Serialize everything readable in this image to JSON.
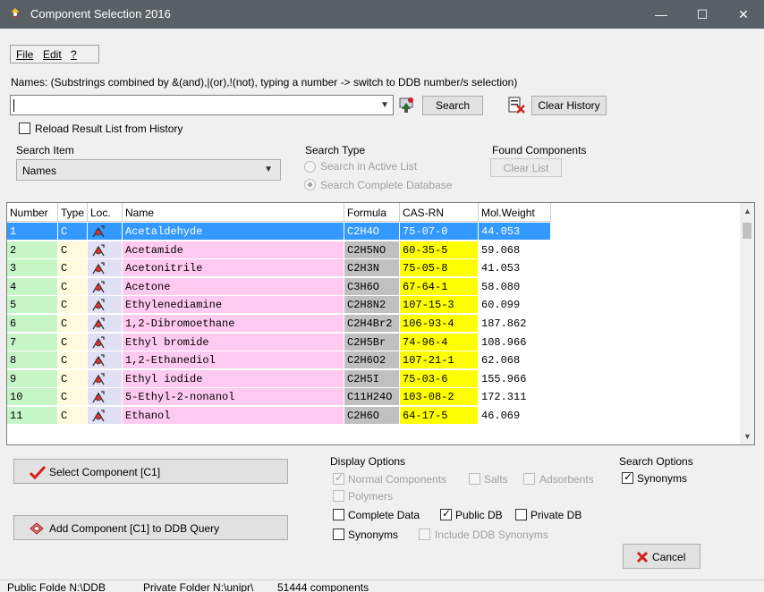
{
  "window": {
    "title": "Component Selection 2016",
    "minimize": "—",
    "maximize": "☐",
    "close": "✕"
  },
  "menu": {
    "file": "File",
    "edit": "Edit",
    "help": "?"
  },
  "names_label": "Names: (Substrings combined by &(and),|(or),!(not), typing a number -> switch to DDB number/s selection)",
  "search_input": {
    "value": ""
  },
  "buttons": {
    "search": "Search",
    "clear_history": "Clear History",
    "clear_list": "Clear List",
    "select_component": "Select Component [C1]",
    "add_component": "Add Component [C1] to DDB Query",
    "cancel": "Cancel"
  },
  "reload_history": "Reload Result List from History",
  "search_item": {
    "label": "Search Item",
    "selected": "Names"
  },
  "search_type": {
    "label": "Search Type",
    "active_list": "Search in  Active List",
    "complete_db": "Search Complete Database"
  },
  "found_components_label": "Found Components",
  "table": {
    "columns": [
      "Number",
      "Type",
      "Loc.",
      "Name",
      "Formula",
      "CAS-RN",
      "Mol.Weight"
    ],
    "rows": [
      {
        "number": "1",
        "type": "C",
        "name": "Acetaldehyde",
        "formula": "C2H4O",
        "cas": "75-07-0",
        "mw": "44.053"
      },
      {
        "number": "2",
        "type": "C",
        "name": "Acetamide",
        "formula": "C2H5NO",
        "cas": "60-35-5",
        "mw": "59.068"
      },
      {
        "number": "3",
        "type": "C",
        "name": "Acetonitrile",
        "formula": "C2H3N",
        "cas": "75-05-8",
        "mw": "41.053"
      },
      {
        "number": "4",
        "type": "C",
        "name": "Acetone",
        "formula": "C3H6O",
        "cas": "67-64-1",
        "mw": "58.080"
      },
      {
        "number": "5",
        "type": "C",
        "name": "Ethylenediamine",
        "formula": "C2H8N2",
        "cas": "107-15-3",
        "mw": "60.099"
      },
      {
        "number": "6",
        "type": "C",
        "name": "1,2-Dibromoethane",
        "formula": "C2H4Br2",
        "cas": "106-93-4",
        "mw": "187.862"
      },
      {
        "number": "7",
        "type": "C",
        "name": "Ethyl bromide",
        "formula": "C2H5Br",
        "cas": "74-96-4",
        "mw": "108.966"
      },
      {
        "number": "8",
        "type": "C",
        "name": "1,2-Ethanediol",
        "formula": "C2H6O2",
        "cas": "107-21-1",
        "mw": "62.068"
      },
      {
        "number": "9",
        "type": "C",
        "name": "Ethyl iodide",
        "formula": "C2H5I",
        "cas": "75-03-6",
        "mw": "155.966"
      },
      {
        "number": "10",
        "type": "C",
        "name": "5-Ethyl-2-nonanol",
        "formula": "C11H24O",
        "cas": "103-08-2",
        "mw": "172.311"
      },
      {
        "number": "11",
        "type": "C",
        "name": "Ethanol",
        "formula": "C2H6O",
        "cas": "64-17-5",
        "mw": "46.069"
      }
    ],
    "selected_row": 0
  },
  "display_options": {
    "label": "Display Options",
    "normal_components": "Normal Components",
    "salts": "Salts",
    "adsorbents": "Adsorbents",
    "polymers": "Polymers",
    "complete_data": "Complete Data",
    "public_db": "Public DB",
    "private_db": "Private DB",
    "synonyms": "Synonyms",
    "include_ddb_synonyms": "Include DDB Synonyms"
  },
  "search_options": {
    "label": "Search Options",
    "synonyms": "Synonyms"
  },
  "status": {
    "public_folder": "Public Folde  N:\\DDB",
    "private_folder": "Private Folder  N:\\unipr\\",
    "count": "51444 components"
  },
  "colors": {
    "titlebar": "#596166",
    "col_number": "#c6f5c6",
    "col_type": "#fffbdc",
    "col_loc": "#e0e0f5",
    "col_name": "#ffcaf0",
    "col_formula": "#c0c0c0",
    "col_cas": "#ffff00",
    "selection": "#3399ff"
  }
}
